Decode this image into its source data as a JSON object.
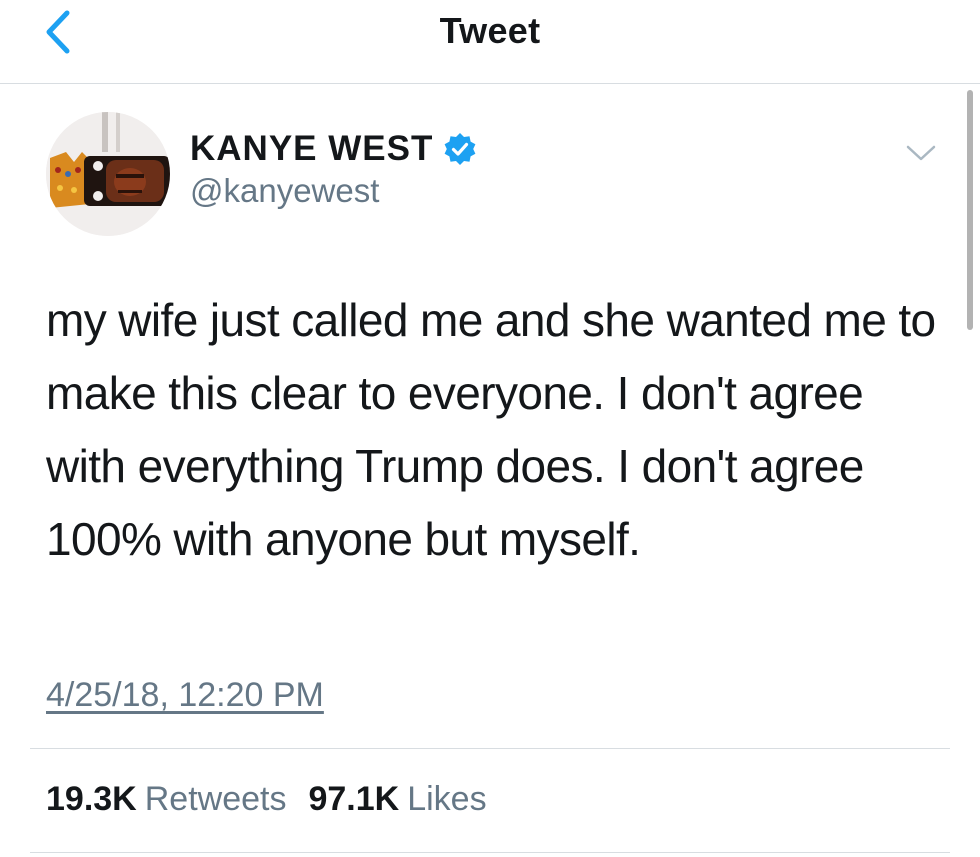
{
  "header": {
    "title": "Tweet",
    "back_icon": "chevron-left-icon"
  },
  "author": {
    "name": "KANYE WEST",
    "handle": "@kanyewest",
    "verified": true,
    "badge_color": "#1da1f2"
  },
  "tweet": {
    "text": "my wife just called me and she wanted me to make this clear to everyone. I don't agree with everything Trump does. I don't agree 100% with anyone but myself.",
    "timestamp": "4/25/18, 12:20 PM"
  },
  "stats": {
    "retweets_count": "19.3K",
    "retweets_label": "Retweets",
    "likes_count": "97.1K",
    "likes_label": "Likes"
  },
  "colors": {
    "accent": "#1da1f2",
    "text": "#14171a",
    "muted": "#657786",
    "divider": "#d8dde1"
  }
}
